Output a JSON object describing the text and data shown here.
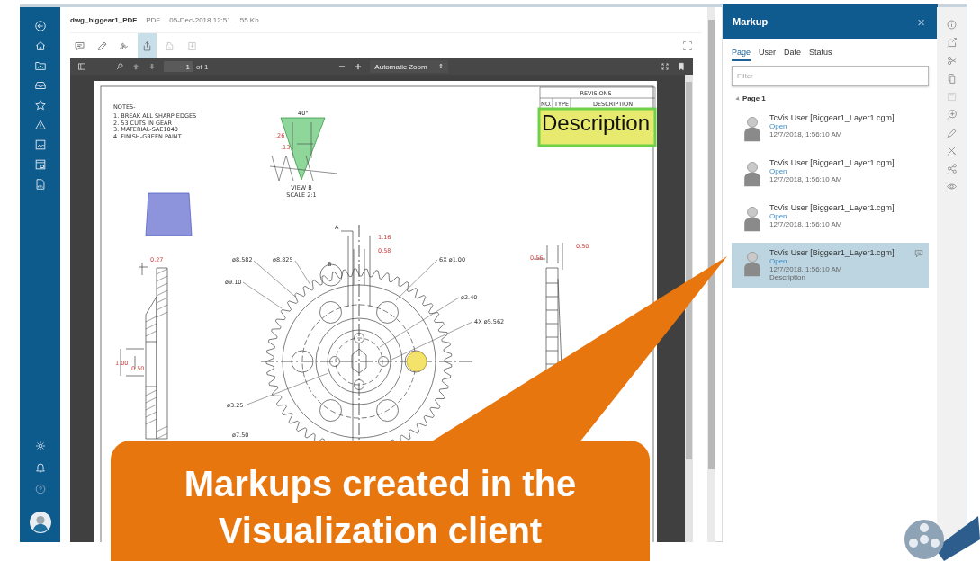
{
  "document": {
    "filename": "dwg_biggear1_PDF",
    "type": "PDF",
    "date": "05-Dec-2018 12:51",
    "size": "55 Kb"
  },
  "tools": [
    {
      "selected": false,
      "disabled": false
    },
    {
      "selected": false,
      "disabled": false
    },
    {
      "selected": false,
      "disabled": false
    },
    {
      "selected": true,
      "disabled": false
    },
    {
      "selected": false,
      "disabled": true
    },
    {
      "selected": false,
      "disabled": true
    }
  ],
  "viewer": {
    "page": "1",
    "page_count": "of 1",
    "zoom": "Automatic Zoom",
    "zoom_caret": "⇕"
  },
  "drawing": {
    "notes_title": "NOTES-",
    "notes": [
      "1. BREAK ALL SHARP EDGES",
      "2. 53 CUTS IN GEAR",
      "3. MATERIAL-SAE1040",
      "4. FINISH-GREEN PAINT"
    ],
    "view_label": [
      "VIEW B",
      "SCALE 2:1"
    ],
    "revisions": {
      "title": "REVISIONS",
      "columns": [
        "NO.",
        "TYPE",
        "DESCRIPTION"
      ]
    },
    "markup_text": "Description",
    "labels": [
      {
        "text": "40°",
        "kind": "label"
      },
      {
        "text": ".26",
        "kind": "dimension"
      },
      {
        "text": ".13",
        "kind": "dimension"
      },
      {
        "text": "A",
        "kind": "label"
      },
      {
        "text": "1.16",
        "kind": "dimension"
      },
      {
        "text": "0.58",
        "kind": "dimension"
      },
      {
        "text": "0.27",
        "kind": "dimension"
      },
      {
        "text": "ø8.582",
        "kind": "label"
      },
      {
        "text": "ø8.825",
        "kind": "label"
      },
      {
        "text": "B",
        "kind": "label"
      },
      {
        "text": "6X ø1.00",
        "kind": "label"
      },
      {
        "text": "ø9.10",
        "kind": "label"
      },
      {
        "text": "ø2.40",
        "kind": "label"
      },
      {
        "text": "4X ø5.562",
        "kind": "label"
      },
      {
        "text": "1.00",
        "kind": "dimension"
      },
      {
        "text": "0.50",
        "kind": "dimension"
      },
      {
        "text": "ø3.25",
        "kind": "label"
      },
      {
        "text": "ø7.50",
        "kind": "label"
      },
      {
        "text": "0.56",
        "kind": "dimension"
      },
      {
        "text": "0.50",
        "kind": "dimension"
      }
    ]
  },
  "markup_panel": {
    "title": "Markup",
    "close": "×",
    "tabs": [
      {
        "label": "Page",
        "selected": true
      },
      {
        "label": "User",
        "selected": false
      },
      {
        "label": "Date",
        "selected": false
      },
      {
        "label": "Status",
        "selected": false
      }
    ],
    "filter": {
      "placeholder": "Filter"
    },
    "group": {
      "label": "Page 1",
      "expanded": true
    },
    "items": [
      {
        "author": "TcVis User [Biggear1_Layer1.cgm]",
        "status": "Open",
        "date": "12/7/2018, 1:56:10 AM",
        "selected": false
      },
      {
        "author": "TcVis User [Biggear1_Layer1.cgm]",
        "status": "Open",
        "date": "12/7/2018, 1:56:10 AM",
        "selected": false
      },
      {
        "author": "TcVis User [Biggear1_Layer1.cgm]",
        "status": "Open",
        "date": "12/7/2018, 1:56:10 AM",
        "selected": false
      },
      {
        "author": "TcVis User [Biggear1_Layer1.cgm]",
        "status": "Open",
        "date": "12/7/2018, 1:56:10 AM",
        "description": "Description",
        "selected": true
      }
    ]
  },
  "side_tools": [
    {
      "disabled": false
    },
    {
      "disabled": false
    },
    {
      "disabled": false
    },
    {
      "disabled": false
    },
    {
      "disabled": true
    },
    {
      "disabled": false
    },
    {
      "disabled": false
    },
    {
      "disabled": false
    },
    {
      "disabled": false
    },
    {
      "disabled": false
    }
  ],
  "callout": {
    "text": "Markups created in the Visualization client"
  }
}
